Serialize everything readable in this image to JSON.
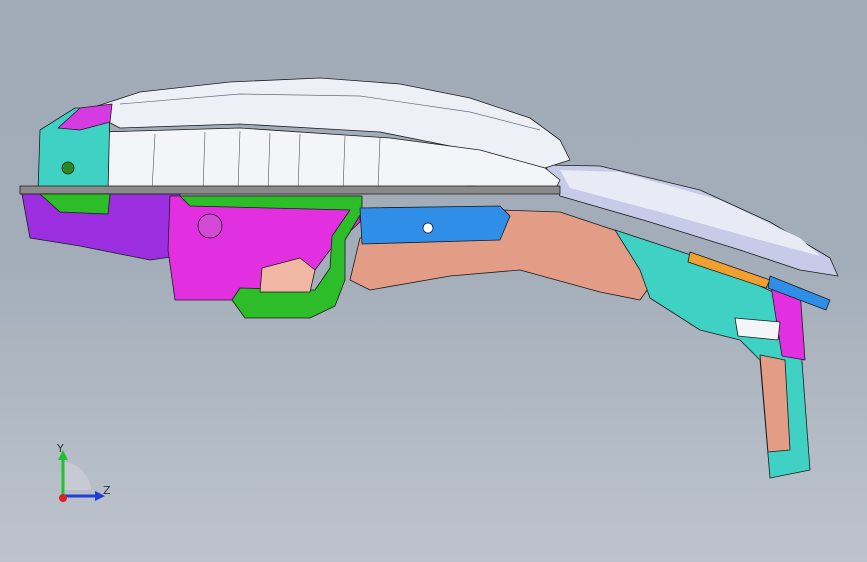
{
  "viewport": {
    "background_top": "#a2acb8",
    "background_bottom": "#bcc3cc"
  },
  "model": {
    "colors": {
      "roof": "#e9ecf5",
      "roof_shade": "#c9cde6",
      "side_panel": "#f2f3f6",
      "cyan_part": "#3fd1c4",
      "purple_part": "#9b2fe0",
      "magenta_part": "#e22fe0",
      "green_part": "#2dbd28",
      "blue_part": "#2f8fe8",
      "salmon_part": "#e39d86",
      "orange_part": "#f0a030",
      "outline": "#1b1b1b"
    }
  },
  "triad": {
    "y_label": "Y",
    "z_label": "Z",
    "y_color": "#22c033",
    "z_color": "#1f3fd8",
    "x_color": "#e02020"
  }
}
